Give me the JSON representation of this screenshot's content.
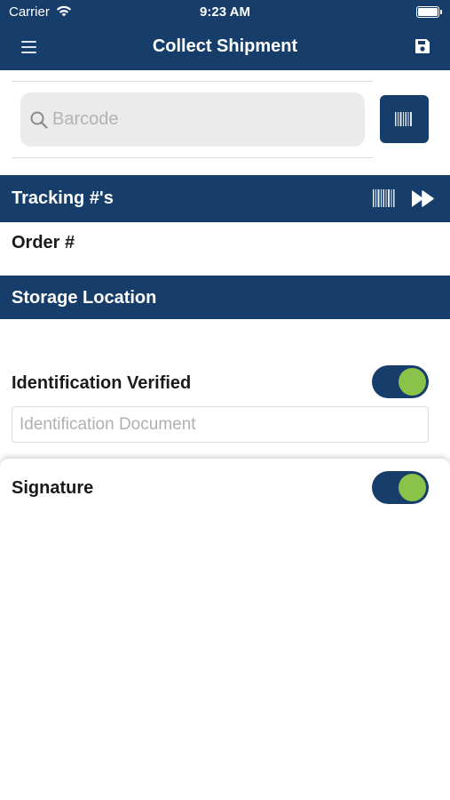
{
  "status_bar": {
    "carrier": "Carrier",
    "time": "9:23 AM"
  },
  "nav": {
    "title": "Collect Shipment",
    "menu_icon": "menu-icon",
    "save_icon": "floppy-disk-icon"
  },
  "search": {
    "placeholder": "Barcode",
    "value": ""
  },
  "sections": {
    "tracking": {
      "title": "Tracking #'s",
      "icons": [
        "barcode-icon",
        "fast-forward-icon"
      ]
    },
    "storage": {
      "title": "Storage Location"
    }
  },
  "order_label": "Order #",
  "identification": {
    "label": "Identification Verified",
    "enabled": true,
    "document_placeholder": "Identification Document",
    "document_value": ""
  },
  "signature": {
    "label": "Signature",
    "enabled": true
  },
  "colors": {
    "primary": "#173e6b",
    "toggle_on": "#8bc34a",
    "search_bg": "#ebebeb"
  }
}
